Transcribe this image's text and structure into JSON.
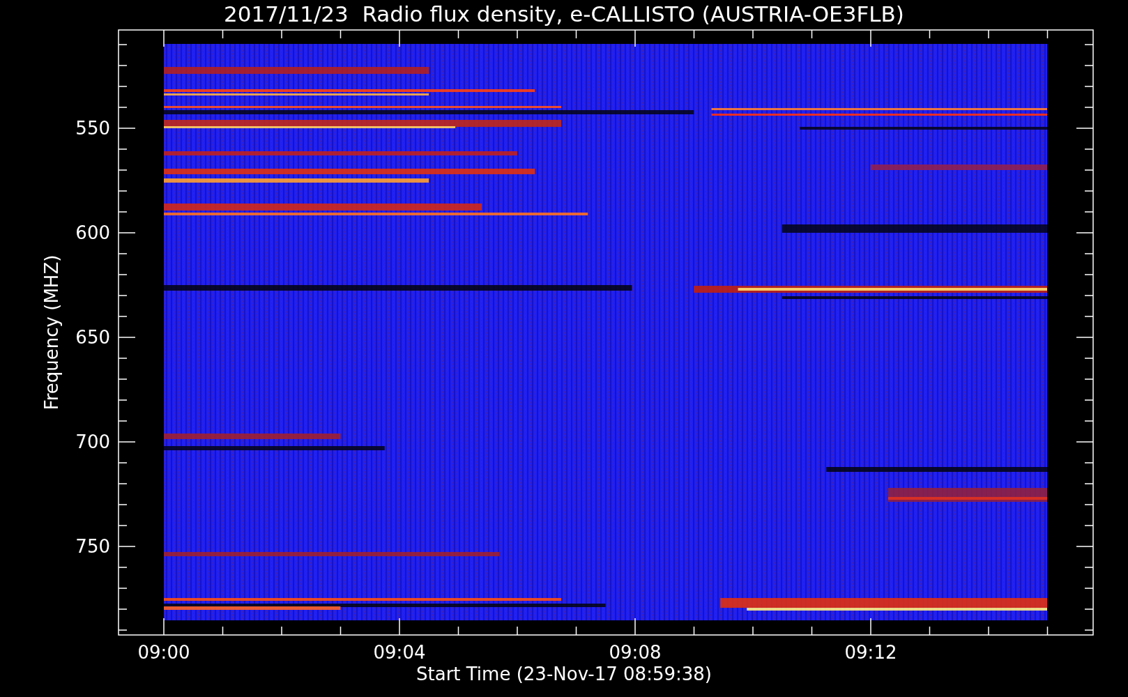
{
  "plot": {
    "title": "2017/11/23  Radio flux density, e-CALLISTO (AUSTRIA-OE3FLB)",
    "ylabel": "Frequency (MHZ)",
    "xlabel": "Start Time (23-Nov-17 08:59:38)",
    "yticks": [
      "550",
      "600",
      "650",
      "700",
      "750"
    ],
    "xticks": [
      "09:00",
      "09:04",
      "09:08",
      "09:12"
    ]
  }
}
